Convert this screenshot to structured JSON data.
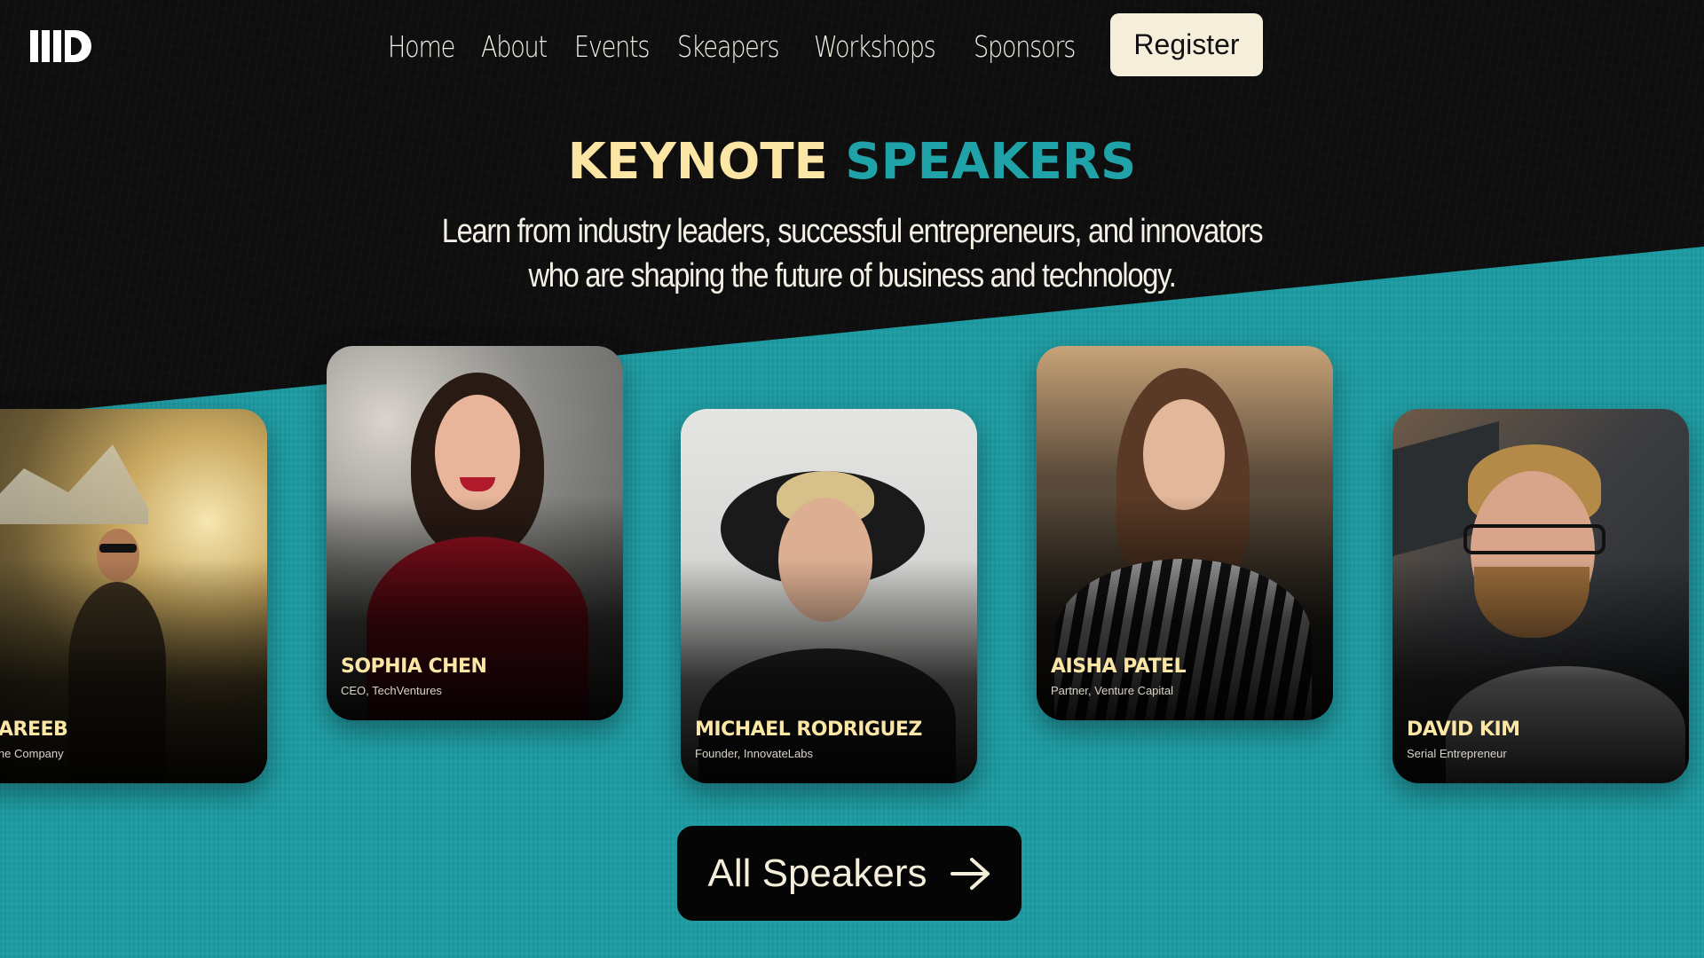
{
  "nav": {
    "items": [
      {
        "label": "Home"
      },
      {
        "label": "About"
      },
      {
        "label": "Events"
      },
      {
        "label": "Skeapers"
      },
      {
        "label": "Workshops"
      },
      {
        "label": "Sponsors"
      }
    ],
    "register_label": "Register"
  },
  "hero": {
    "title_part1": "KEYNOTE",
    "title_part2": "SPEAKERS",
    "subtitle": "Learn from industry leaders, successful entrepreneurs, and innovators who are shaping the future of business and technology."
  },
  "speakers": [
    {
      "name": ". AREEB",
      "role": ", The Company"
    },
    {
      "name": "SOPHIA CHEN",
      "role": "CEO, TechVentures"
    },
    {
      "name": "MICHAEL RODRIGUEZ",
      "role": "Founder, InnovateLabs"
    },
    {
      "name": "AISHA PATEL",
      "role": "Partner, Venture Capital"
    },
    {
      "name": "DAVID KIM",
      "role": "Serial Entrepreneur"
    }
  ],
  "cta": {
    "label": "All Speakers",
    "icon": "arrow-right-icon"
  },
  "colors": {
    "teal": "#1c9ba2",
    "cream": "#fbe6a6",
    "dark": "#0e0e0e"
  }
}
